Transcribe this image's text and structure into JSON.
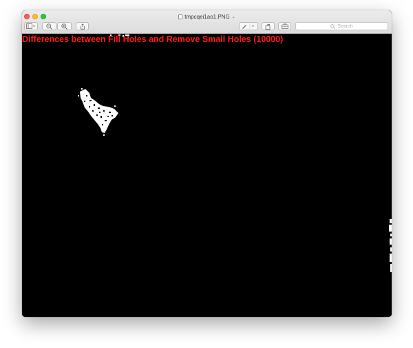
{
  "window": {
    "title": "tmpcqei1ao1.PNG"
  },
  "toolbar": {
    "search_placeholder": "Search",
    "buttons": [
      "sidebar-toggle",
      "zoom-out",
      "zoom-in",
      "share",
      "markup",
      "rotate",
      "toolbox"
    ]
  },
  "image": {
    "overlay_title": "Differences between Fill Holes and Remove Small Holes (10000)",
    "overlay_color": "#ff1a1a",
    "background_color": "#000000",
    "blob_color": "#ffffff"
  },
  "icons": {
    "sidebar": "sidebar-icon",
    "zoom_out": "zoom-out-icon",
    "zoom_in": "zoom-in-icon",
    "share": "share-icon",
    "markup": "pen-icon",
    "rotate": "rotate-icon",
    "toolbox": "toolbox-icon",
    "search": "search-icon"
  }
}
